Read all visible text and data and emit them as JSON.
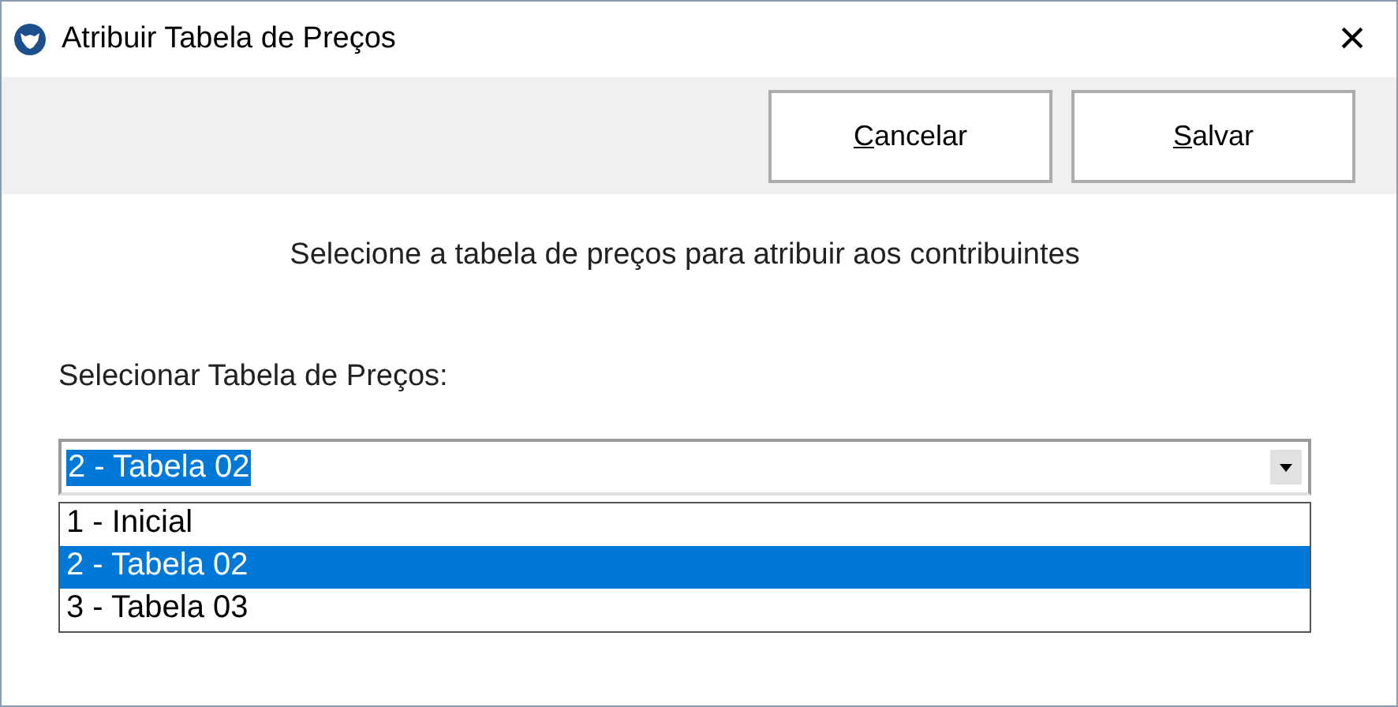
{
  "window": {
    "title": "Atribuir Tabela de Preços",
    "close": "×"
  },
  "buttons": [
    {
      "key": "C",
      "rest": "ancelar"
    },
    {
      "key": "S",
      "rest": "alvar"
    }
  ],
  "message": "Selecione a tabela de preços para atribuir aos contribuintes",
  "field_label": "Selecionar Tabela de Preços:",
  "combo": {
    "value": "2 - Tabela 02",
    "expanded": true,
    "options": [
      {
        "label": "1 - Inicial",
        "selected": false
      },
      {
        "label": "2 - Tabela 02",
        "selected": true
      },
      {
        "label": "3 - Tabela 03",
        "selected": false
      }
    ]
  }
}
